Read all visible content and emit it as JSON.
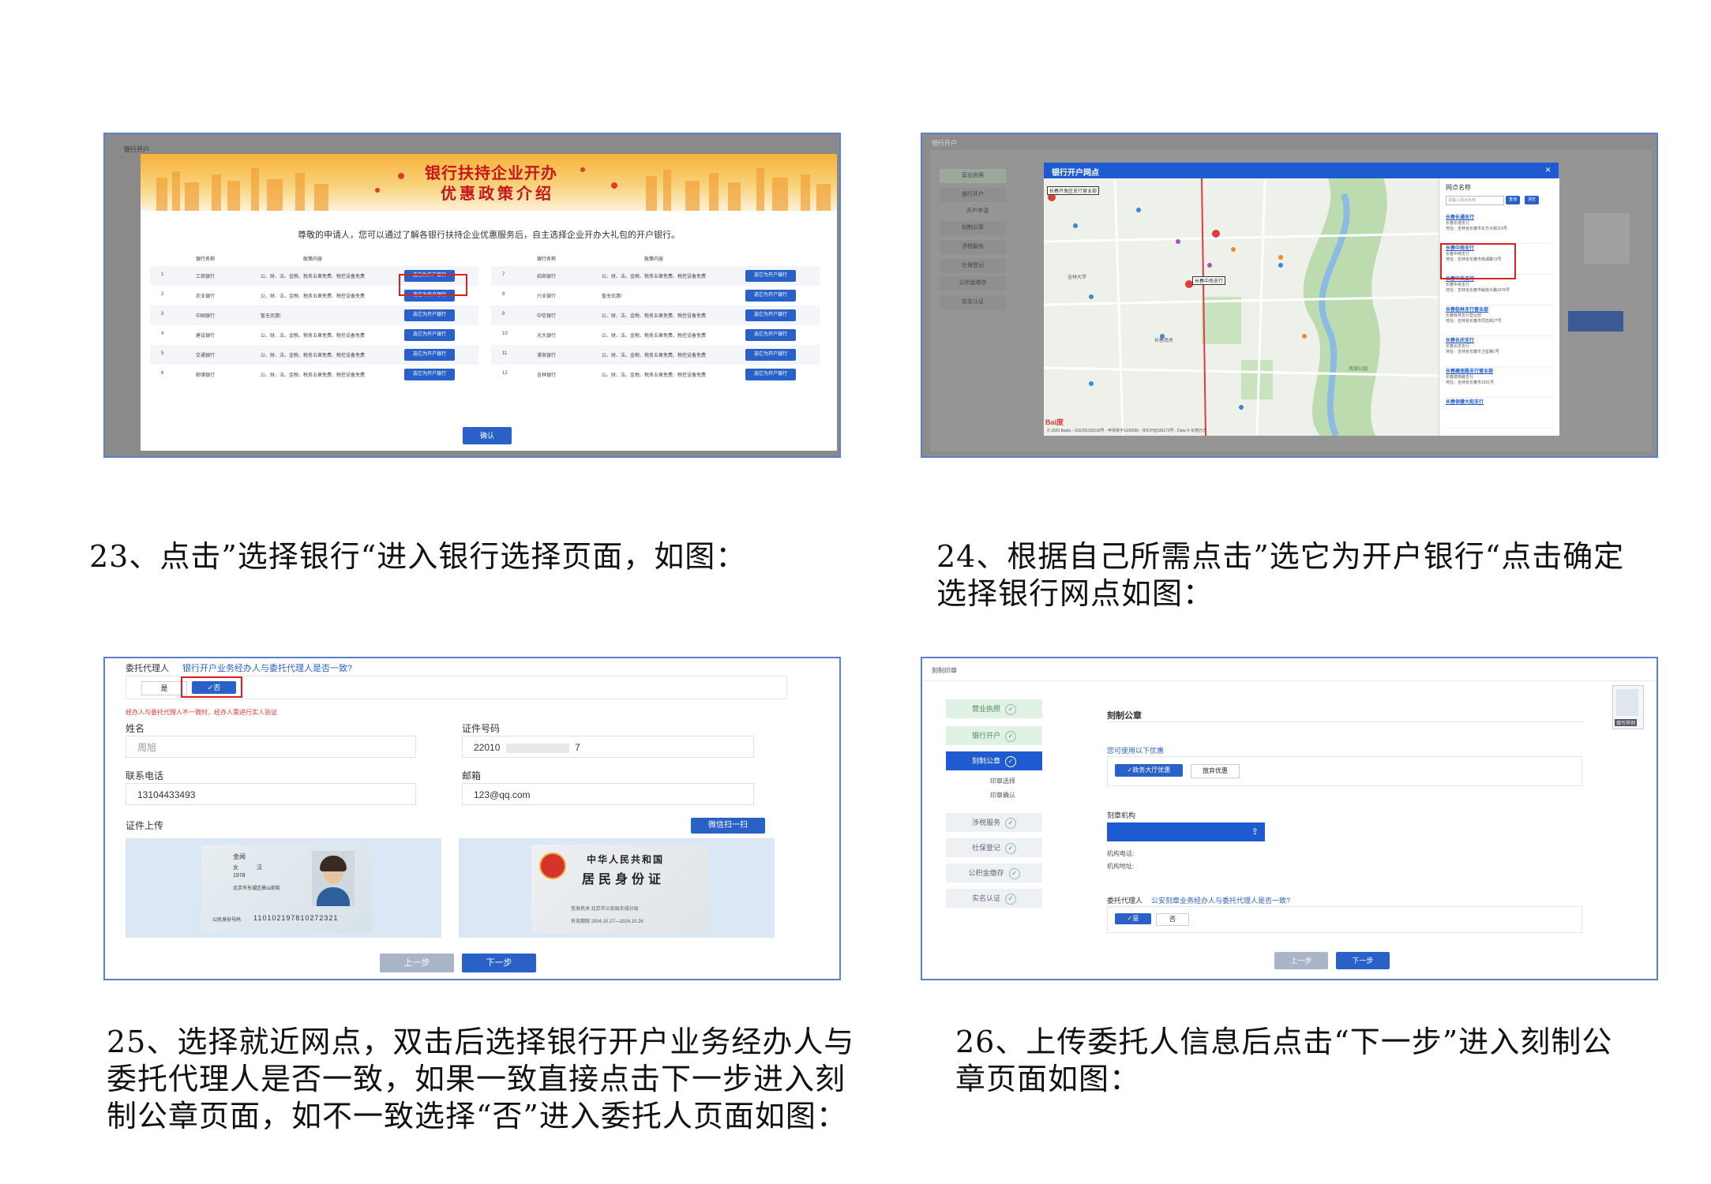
{
  "captions": {
    "c23": "23、点击”选择银行“进入银行选择页面，如图：",
    "c24_l1": "24、根据自己所需点击”选它为开户银行“点击确定",
    "c24_l2": "选择银行网点如图：",
    "c25_l1": "25、选择就近网点，双击后选择银行开户业务经办人与",
    "c25_l2": "委托代理人是否一致，如果一致直接点击下一步进入刻",
    "c25_l3": "制公章页面，如不一致选择“否”进入委托人页面如图：",
    "c26_l1": "26、上传委托人信息后点击“下一步”进入刻制公",
    "c26_l2": "章页面如图："
  },
  "shot1": {
    "breadcrumb": "银行开户",
    "banner_l1": "银行扶持企业开办",
    "banner_l2": "优惠政策介绍",
    "intro": "尊敬的申请人，您可以通过了解各银行扶持企业优惠服务后，自主选择企业开办大礼包的开户银行。",
    "col_bank": "银行名称",
    "col_policy": "政策内容",
    "select_label": "选它为开户银行",
    "confirm": "确认",
    "left_rows": [
      {
        "no": "1",
        "bank": "工商银行",
        "policy": "公、财、法、金税、税务五章免费、税控设备免费"
      },
      {
        "no": "2",
        "bank": "农业银行",
        "policy": "公、财、法、金税、税务五章免费、税控设备免费"
      },
      {
        "no": "3",
        "bank": "中国银行",
        "policy": "暂无优惠!"
      },
      {
        "no": "4",
        "bank": "建设银行",
        "policy": "公、财、法、金税、税务五章免费、税控设备免费"
      },
      {
        "no": "5",
        "bank": "交通银行",
        "policy": "公、财、法、金税、税务五章免费、税控设备免费"
      },
      {
        "no": "6",
        "bank": "邮储银行",
        "policy": "公、财、法、金税、税务五章免费、税控设备免费"
      }
    ],
    "right_rows": [
      {
        "no": "7",
        "bank": "招商银行",
        "policy": "公、财、法、金税、税务五章免费、税控设备免费"
      },
      {
        "no": "8",
        "bank": "兴业银行",
        "policy": "暂无优惠!"
      },
      {
        "no": "9",
        "bank": "中信银行",
        "policy": "公、财、法、金税、税务五章免费、税控设备免费"
      },
      {
        "no": "10",
        "bank": "光大银行",
        "policy": "公、财、法、金税、税务五章免费、税控设备免费"
      },
      {
        "no": "11",
        "bank": "浦发银行",
        "policy": "公、财、法、金税、税务五章免费、税控设备免费"
      },
      {
        "no": "12",
        "bank": "吉林银行",
        "policy": "公、财、法、金税、税务五章免费、税控设备免费"
      }
    ]
  },
  "shot2": {
    "breadcrumb": "银行开户",
    "sidebar": [
      "营业执照",
      "银行开户",
      "开户申请",
      "刻制公章",
      "涉税服务",
      "社保登记",
      "公积金缴存",
      "实名认证"
    ],
    "modal_title": "银行开户网点",
    "close": "×",
    "panel_title": "网点名称",
    "search_placeholder": "请输入网点名称",
    "search_btn": "查询",
    "clear_btn": "清空",
    "branches": [
      {
        "name": "长春长通支行",
        "l1": "长春长通支行",
        "l2": "地址：吉林省长春市东方大街119号"
      },
      {
        "name": "长春中南支行",
        "l1": "长春中南支行",
        "l2": "地址：吉林省长春市南湖路73号"
      },
      {
        "name": "长春中央支行",
        "l1": "长春中央支行",
        "l2": "地址：吉林省长春市解放大路1976号"
      },
      {
        "name": "长春桂林支行营业部",
        "l1": "长春桂林支行营业部",
        "l2": "地址：吉林省长春市同志街27号"
      },
      {
        "name": "长春长庆支行",
        "l1": "长春长庆支行",
        "l2": "地址：吉林省长春市卫星路1号"
      },
      {
        "name": "长春建南路支行营业部",
        "l1": "长春建南路支行",
        "l2": "地址：吉林省长春市1001号"
      },
      {
        "name": "长春保健大街支行",
        "l1": "",
        "l2": ""
      }
    ],
    "map_labels": [
      "长春开发区支行营业部",
      "长春中南支行",
      "长春南关",
      "吉林大学",
      "南湖公园"
    ],
    "map_footer": "© 2020 Baidu - GS(2019)5218号 - 甲测资字1100930 - 京ICP证030173号 - Data © 长地万方"
  },
  "shot3": {
    "agent_label": "委托代理人",
    "agent_question": "银行开户业务经办人与委托代理人是否一致?",
    "yes": "是",
    "no": "✓否",
    "warning": "经办人与委托代理人不一致时，经办人需进行实人验证",
    "name_label": "姓名",
    "name_value": "周旭",
    "idno_label": "证件号码",
    "idno_value": "22010",
    "idno_tail": "7",
    "phone_label": "联系电话",
    "phone_value": "13104433493",
    "email_label": "邮箱",
    "email_value": "123@qq.com",
    "upload_label": "证件上传",
    "wechat_btn": "微信扫一扫",
    "id_front": {
      "name": "金闻",
      "sex": "女",
      "nation": "汉",
      "born": "1978",
      "addr": "北京市东城区景山前街",
      "num": "110102197810272321",
      "num_label": "公民身份号码"
    },
    "id_back": {
      "l1": "中华人民共和国",
      "l2": "居民身份证",
      "l3": "签发机关  北京市公安局东城分局",
      "l4": "有效期限  2004.10.27—2024.10.26"
    },
    "prev": "上一步",
    "next": "下一步"
  },
  "shot4": {
    "breadcrumb": "刻制印章",
    "sidebar": [
      "营业执照",
      "银行开户",
      "刻制公章",
      "印章选择",
      "印章确认",
      "涉税服务",
      "社保登记",
      "公积金缴存",
      "实名认证"
    ],
    "section": "刻制公章",
    "discount_label": "您可使用以下优惠",
    "opt1": "✓政务大厅优惠",
    "opt2": "放弃优惠",
    "org_label": "刻章机构",
    "org_phone": "机构电话:",
    "org_addr": "机构地址:",
    "agent_label": "委托代理人",
    "agent_question": "公安刻章业务经办人与委托代理人是否一致?",
    "yes": "✓是",
    "no": "否",
    "prev": "上一步",
    "next": "下一步",
    "thumb_label": "填写样例"
  }
}
